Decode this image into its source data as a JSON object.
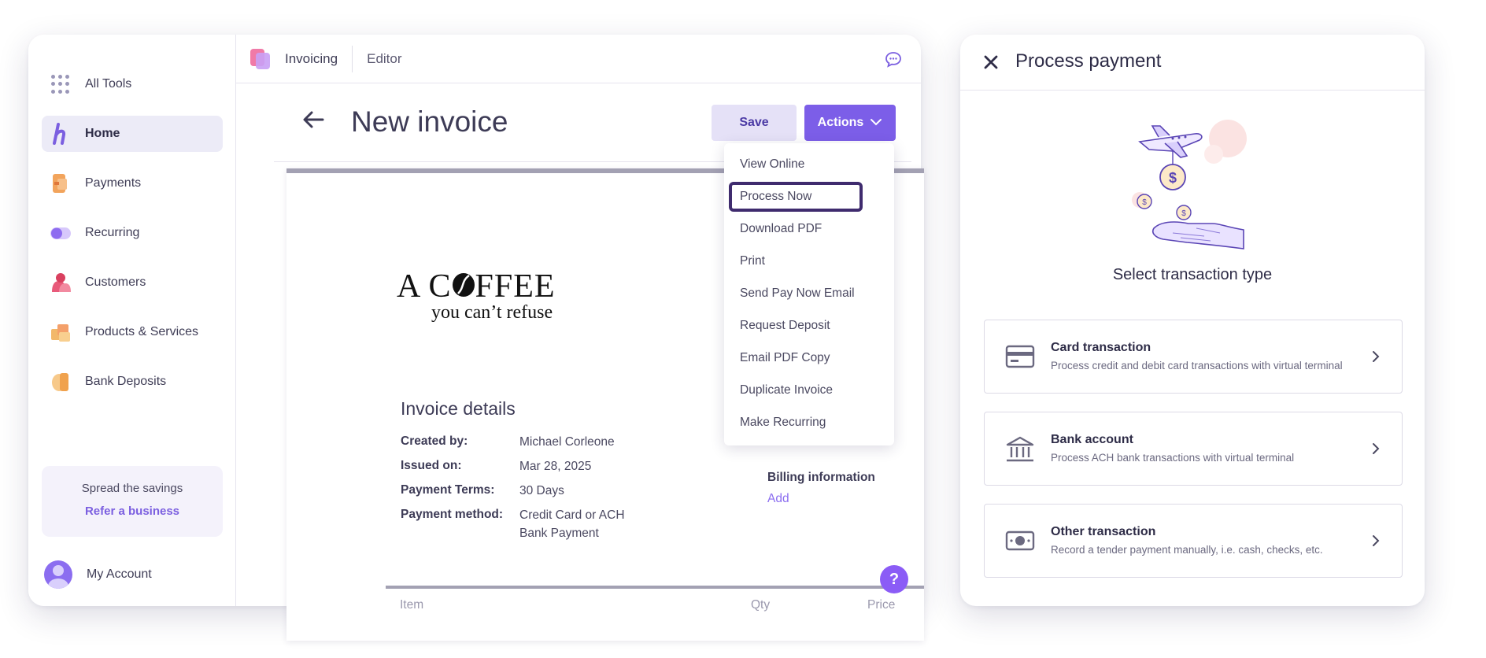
{
  "colors": {
    "accent": "#7c5ee8",
    "accent_light": "#e5e1f7",
    "link": "#7b5fe0",
    "text_dark": "#2e2c47"
  },
  "sidebar": {
    "all_tools": "All Tools",
    "items": [
      {
        "label": "Home",
        "icon": "home-h-icon",
        "active": true
      },
      {
        "label": "Payments",
        "icon": "payments-icon"
      },
      {
        "label": "Recurring",
        "icon": "recurring-icon"
      },
      {
        "label": "Customers",
        "icon": "customers-icon"
      },
      {
        "label": "Products & Services",
        "icon": "products-icon"
      },
      {
        "label": "Bank Deposits",
        "icon": "bank-deposits-icon"
      }
    ],
    "refer": {
      "text": "Spread the savings",
      "link": "Refer a business"
    },
    "account": "My Account"
  },
  "topbar": {
    "app": "Invoicing",
    "section": "Editor"
  },
  "page": {
    "title": "New invoice",
    "save": "Save",
    "actions": "Actions"
  },
  "actions_menu": [
    "View Online",
    "Process Now",
    "Download PDF",
    "Print",
    "Send Pay Now Email",
    "Request Deposit",
    "Email PDF Copy",
    "Duplicate Invoice",
    "Make Recurring"
  ],
  "invoice": {
    "logo_line1_a": "A C",
    "logo_line1_b": "FFEE",
    "logo_line2": "you can’t refuse",
    "details_title": "Invoice details",
    "details": [
      {
        "label": "Created by:",
        "value": "Michael Corleone"
      },
      {
        "label": "Issued on:",
        "value": "Mar 28, 2025"
      },
      {
        "label": "Payment Terms:",
        "value": "30 Days"
      },
      {
        "label": "Payment method:",
        "value": "Credit Card or ACH",
        "value2": "Bank Payment"
      }
    ],
    "billing_label": "Billing information",
    "billing_add": "Add",
    "table_headers": {
      "item": "Item",
      "qty": "Qty",
      "price": "Price"
    }
  },
  "help": "?",
  "panel": {
    "title": "Process payment",
    "subtitle": "Select transaction type",
    "options": [
      {
        "title": "Card transaction",
        "desc": "Process credit and debit card transactions with virtual terminal",
        "icon": "credit-card-icon"
      },
      {
        "title": "Bank account",
        "desc": "Process ACH bank transactions with virtual terminal",
        "icon": "bank-icon"
      },
      {
        "title": "Other transaction",
        "desc": "Record a tender payment manually, i.e. cash, checks, etc.",
        "icon": "cash-icon"
      }
    ]
  }
}
